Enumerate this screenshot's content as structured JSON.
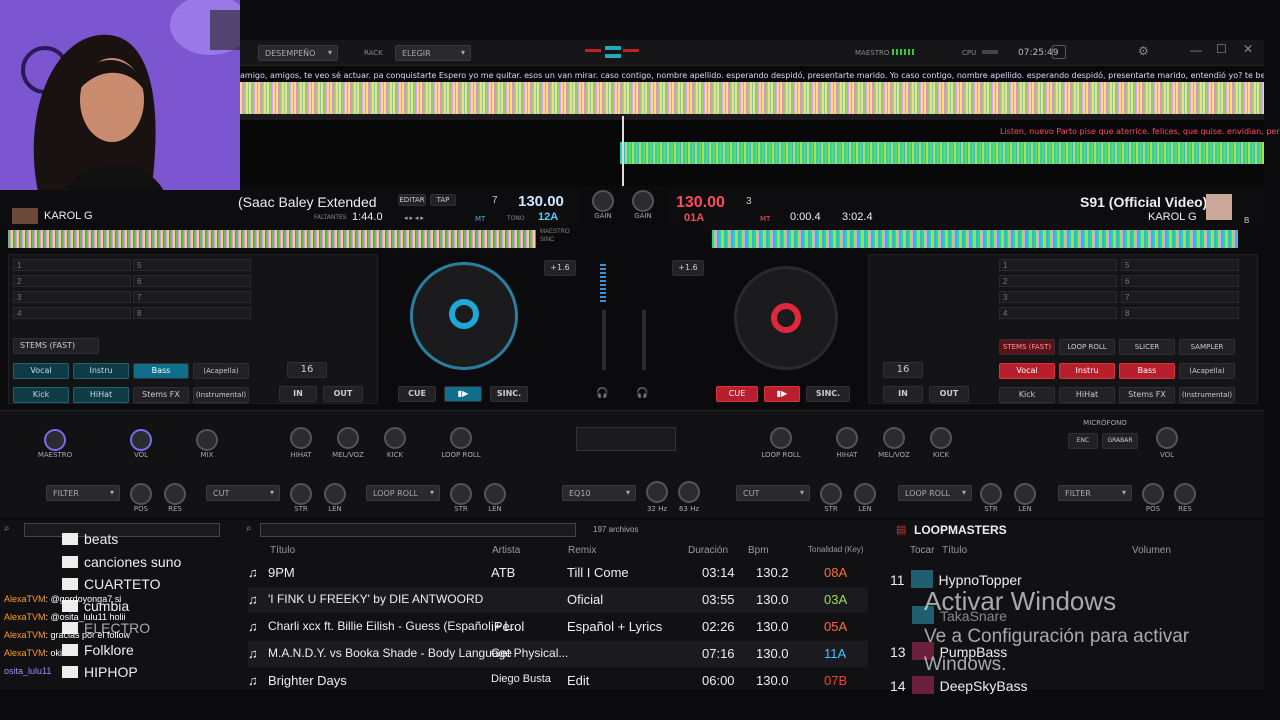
{
  "window": {
    "time": "07:25:49",
    "layout": "DESEMPEÑO",
    "rack_label": "RACK",
    "rack_value": "ELEGIR",
    "master_label": "MAESTRO",
    "cpu_label": "CPU"
  },
  "lyrics": {
    "top": "amigo, amigos, te veo sé actuar. pa conquistarte Espero yo me quitar. esos un van mirar. caso contigo, nombre apellido. esperando despidó, presentarte marido. Yo caso contigo, nombre apellido. esperando despidó, presentarte marido, entendió yo? te besar tan como timida con gana l",
    "right": "Listen, nuevo Parto pise que aterrice. felices, que quise. envidian, perre"
  },
  "deckA": {
    "title": "(Saac Baley Extended",
    "artist": "KAROL G",
    "remaining_label": "FALTANTES",
    "remaining": "1:44.0",
    "bpm": "130.00",
    "deck_num": "7",
    "key": "12A",
    "edit": "EDITAR",
    "tap": "TAP",
    "mt": "MT",
    "tono": "TONO",
    "pitch": "+1.6",
    "loop": "16",
    "in": "IN",
    "out": "OUT",
    "cue": "CUE",
    "sync": "SINC.",
    "maestro": "MAESTRO",
    "sinc": "SINC"
  },
  "deckB": {
    "title": "S91 (Official Video)",
    "artist": "KAROL G",
    "bpm": "130.00",
    "deck_num": "3",
    "key": "01A",
    "elapsed": "0:00.4",
    "total": "3:02.4",
    "mt": "MT",
    "pitch": "+1.6",
    "loop": "16",
    "in": "IN",
    "out": "OUT",
    "cue": "CUE",
    "sync": "SINC.",
    "b": "B"
  },
  "mixer": {
    "gain": "GAIN",
    "gain2": "GAIN"
  },
  "hotcues": [
    "1",
    "2",
    "3",
    "4",
    "5",
    "6",
    "7",
    "8"
  ],
  "stemsA": {
    "mode": "STEMS (FAST)",
    "vocal": "Vocal",
    "instru": "Instru",
    "bass": "Bass",
    "acapella": "(Acapella)",
    "kick": "Kick",
    "hihat": "HiHat",
    "stemsfx": "Stems FX",
    "instrumental": "(Instrumental)"
  },
  "stemsB": {
    "mode": "STEMS (FAST)",
    "loop_roll": "LOOP ROLL",
    "slicer": "SLICER",
    "sampler": "SAMPLER",
    "vocal": "Vocal",
    "instru": "Instru",
    "bass": "Bass",
    "acapella": "(Acapella)",
    "kick": "Kick",
    "hihat": "HiHat",
    "stemsfx": "Stems FX",
    "instrumental": "(Instrumental)"
  },
  "fx": {
    "maestro": "MAESTRO",
    "vol": "VOL",
    "mix": "MIX",
    "hihat": "HIHAT",
    "melvoz": "MEL/VOZ",
    "kick": "KICK",
    "loop_roll": "LOOP ROLL",
    "filter": "FILTER",
    "cut": "CUT",
    "loop_roll_sel": "LOOP ROLL",
    "eq10": "EQ10",
    "pos": "POS",
    "res": "RES",
    "str": "STR",
    "len": "LEN",
    "hz32": "32 Hz",
    "hz63": "63 Hz",
    "micro": "MICRÓFONO",
    "enc": "ENC",
    "grabar": "GRABAR"
  },
  "browser": {
    "count": "197 archivos",
    "headers": {
      "title": "Título",
      "artist": "Artista",
      "remix": "Remix",
      "duration": "Duración",
      "bpm": "Bpm",
      "key": "Tonalidad (Key)"
    },
    "rows": [
      {
        "title": "9PM",
        "artist": "ATB",
        "remix": "Till I Come",
        "duration": "03:14",
        "bpm": "130.2",
        "key": "08A",
        "key_color": "#ff6a3a"
      },
      {
        "title": "'I FINK U FREEKY' by DIE ANTWOORD",
        "artist": "",
        "remix": "Oficial",
        "duration": "03:55",
        "bpm": "130.0",
        "key": "03A",
        "key_color": "#9be04a"
      },
      {
        "title": "Charli xcx ft. Billie Eilish - Guess (Español + L...",
        "artist": "iPerol",
        "remix": "Español + Lyrics",
        "duration": "02:26",
        "bpm": "130.0",
        "key": "05A",
        "key_color": "#ff6a3a"
      },
      {
        "title": "M.A.N.D.Y. vs Booka Shade - Body Language",
        "artist": "Get Physical...",
        "remix": "",
        "duration": "07:16",
        "bpm": "130.0",
        "key": "11A",
        "key_color": "#39c7ff"
      },
      {
        "title": "Brighter Days",
        "artist": "Diego Busta",
        "remix": "Edit",
        "duration": "06:00",
        "bpm": "130.0",
        "key": "07B",
        "key_color": "#ff3a3a"
      }
    ]
  },
  "folders": [
    "beats",
    "canciones suno",
    "CUARTETO",
    "cumbia",
    "ELECTRO",
    "Folklore",
    "HIPHOP"
  ],
  "chat": [
    {
      "user": "AlexaTVM",
      "msg": ": @gordoyonga7 si"
    },
    {
      "user": "AlexaTVM",
      "msg": ": @osita_lulu11 holii"
    },
    {
      "user": "AlexaTVM",
      "msg": ": gracias por el follow"
    },
    {
      "user": "AlexaTVM",
      "msg": ": oki"
    },
    {
      "user": "osita_lulu11",
      "msg": ""
    }
  ],
  "sampler": {
    "title": "LOOPMASTERS",
    "headers": {
      "play": "Tocar",
      "title": "Título",
      "volume": "Volumen"
    },
    "items": [
      {
        "num": "11",
        "name": "HypnoTopper"
      },
      {
        "num": "",
        "name": "TakaSnare"
      },
      {
        "num": "13",
        "name": "PumpBass"
      },
      {
        "num": "14",
        "name": "DeepSkyBass"
      }
    ]
  },
  "watermark": {
    "line1": "Activar Windows",
    "line2": "Ve a Configuración para activar",
    "line3": "Windows."
  },
  "streamer": {
    "name": "KAROL G"
  }
}
